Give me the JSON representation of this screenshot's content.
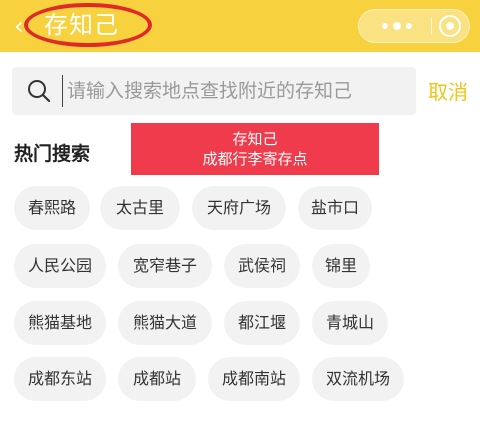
{
  "header": {
    "back_icon": "chevron-left-icon",
    "title": "存知己",
    "highlight_color": "#e02a2a",
    "capsule_icons": [
      "more-dots-icon",
      "target-icon"
    ],
    "bar_color": "#f7d23e"
  },
  "search": {
    "placeholder": "请输入搜索地点查找附近的存知己",
    "value": "",
    "cancel_label": "取消",
    "icon": "search-icon"
  },
  "hot": {
    "title": "热门搜索",
    "chips": [
      "春熙路",
      "太古里",
      "天府广场",
      "盐市口",
      "人民公园",
      "宽窄巷子",
      "武侯祠",
      "锦里",
      "熊猫基地",
      "熊猫大道",
      "都江堰",
      "青城山",
      "成都东站",
      "成都站",
      "成都南站",
      "双流机场"
    ]
  },
  "banner": {
    "line1": "存知己",
    "line2": "成都行李寄存点",
    "color": "#ef3b4b"
  }
}
